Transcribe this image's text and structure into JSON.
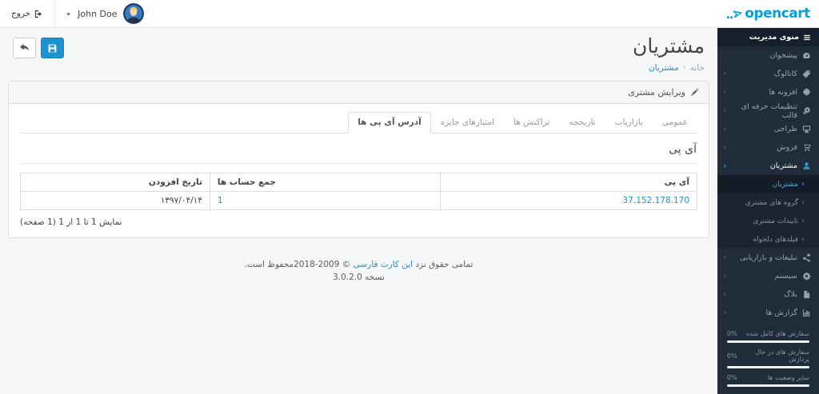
{
  "topbar": {
    "logo": "opencart",
    "user": "John Doe",
    "logout": "خروج"
  },
  "page": {
    "title": "مشتریان",
    "breadcrumb_home": "خانه",
    "breadcrumb_sep": "‹",
    "breadcrumb_current": "مشتریان"
  },
  "panel": {
    "heading": "ویرایش مشتری"
  },
  "tabs": [
    {
      "label": "عمومی",
      "active": false
    },
    {
      "label": "بازاریاب",
      "active": false
    },
    {
      "label": "تاریخچه",
      "active": false
    },
    {
      "label": "تراکنش ها",
      "active": false
    },
    {
      "label": "امتیازهای جایزه",
      "active": false
    },
    {
      "label": "آدرس آی پی ها",
      "active": true
    }
  ],
  "ip_section": {
    "title": "آی پی",
    "headers": {
      "ip": "آی پی",
      "total": "جمع حساب ها",
      "date": "تاریخ افزودن"
    },
    "row": {
      "ip": "37.152.178.170",
      "total": "1",
      "date": "۱۳۹۷/۰۴/۱۴"
    },
    "results": "نمایش 1 تا 1 از 1 (1 صفحه)"
  },
  "footer": {
    "pre": "تمامی حقوق نزد",
    "link": "این کارت فارسی",
    "copyright": "© 2009-2018",
    "post": "محفوظ است.",
    "version": "نسخه 3.0.2.0"
  },
  "sidebar": {
    "header": "منوی مدیریت",
    "items": [
      {
        "label": "پیشخوان",
        "icon": "dashboard-icon"
      },
      {
        "label": "کاتالوگ",
        "icon": "tag-icon"
      },
      {
        "label": "افزونه ها",
        "icon": "puzzle-icon"
      },
      {
        "label": "تنظیمات حرفه ای قالب",
        "icon": "cogs-icon"
      },
      {
        "label": "طراحی",
        "icon": "display-icon"
      },
      {
        "label": "فروش",
        "icon": "cart-icon"
      },
      {
        "label": "مشتریان",
        "icon": "user-icon"
      }
    ],
    "submenu": [
      {
        "label": "مشتریان",
        "active": true
      },
      {
        "label": "گروه های مشتری"
      },
      {
        "label": "تاییدات مشتری"
      },
      {
        "label": "فیلدهای دلخواه"
      }
    ],
    "items_after": [
      {
        "label": "تبلیغات و بازاریابی",
        "icon": "share-icon"
      },
      {
        "label": "سیستم",
        "icon": "gear-icon"
      },
      {
        "label": "بلاگ",
        "icon": "file-icon"
      },
      {
        "label": "گزارش ها",
        "icon": "bar-chart-icon"
      }
    ],
    "stats": [
      {
        "label": "سفارش های کامل شده",
        "value": "0%"
      },
      {
        "label": "سفارش های در حال پردازش",
        "value": "0%"
      },
      {
        "label": "سایر وضعیت ها",
        "value": "0%"
      }
    ]
  },
  "icons": {
    "chevron_left": "‹"
  },
  "colors": {
    "accent_blue": "#1e91cf",
    "logo_blue": "#00a2e1",
    "sidebar_bg": "#212c3a",
    "sidebar_header_bg": "#161f2c",
    "submenu_bg": "#1b2532",
    "submenu_active_bg": "#141c27",
    "content_bg": "#f6f7f8"
  }
}
